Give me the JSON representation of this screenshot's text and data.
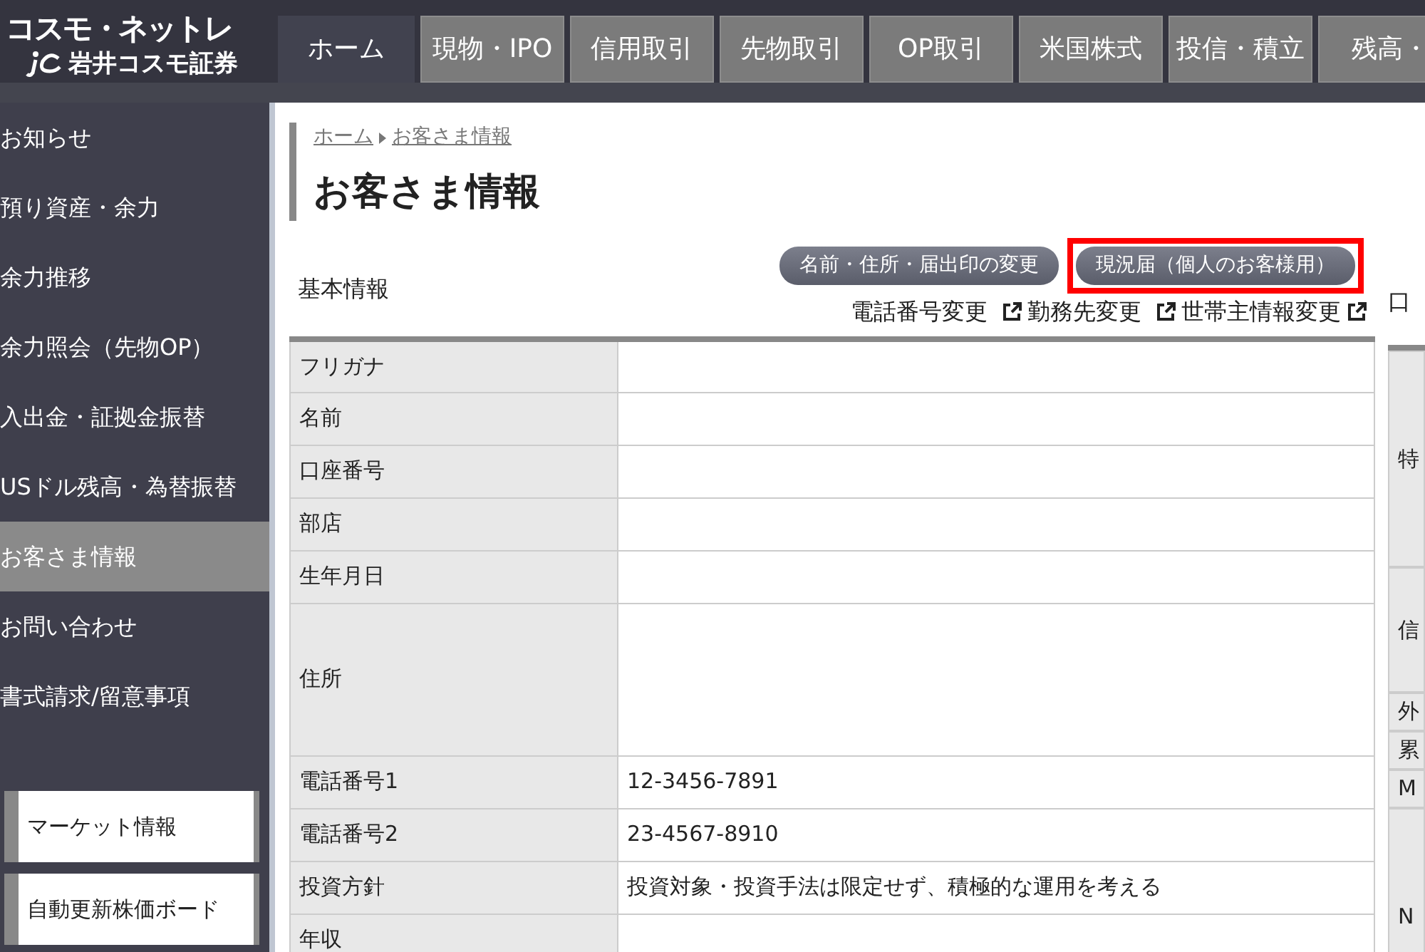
{
  "logo": {
    "title": "コスモ・ネットレ",
    "company": "岩井コスモ証券"
  },
  "tabs": [
    {
      "label": "ホーム",
      "selected": true
    },
    {
      "label": "現物・IPO",
      "selected": false
    },
    {
      "label": "信用取引",
      "selected": false
    },
    {
      "label": "先物取引",
      "selected": false
    },
    {
      "label": "OP取引",
      "selected": false
    },
    {
      "label": "米国株式",
      "selected": false
    },
    {
      "label": "投信・積立",
      "selected": false
    },
    {
      "label": "残高・",
      "selected": false
    }
  ],
  "sidebar": {
    "items": [
      {
        "label": "お知らせ",
        "selected": false
      },
      {
        "label": "預り資産・余力",
        "selected": false
      },
      {
        "label": "余力推移",
        "selected": false
      },
      {
        "label": "余力照会（先物OP）",
        "selected": false
      },
      {
        "label": "入出金・証拠金振替",
        "selected": false
      },
      {
        "label": "USドル残高・為替振替",
        "selected": false
      },
      {
        "label": "お客さま情報",
        "selected": true
      },
      {
        "label": "お問い合わせ",
        "selected": false
      },
      {
        "label": "書式請求/留意事項",
        "selected": false
      }
    ],
    "boxes": [
      "マーケット情報",
      "自動更新株価ボード"
    ]
  },
  "breadcrumb": [
    "ホーム",
    "お客さま情報"
  ],
  "page_title": "お客さま情報",
  "section": "基本情報",
  "buttons": [
    {
      "label": "名前・住所・届出印の変更",
      "highlighted": false
    },
    {
      "label": "現況届（個人のお客様用）",
      "highlighted": true
    }
  ],
  "links": [
    "電話番号変更",
    "勤務先変更",
    "世帯主情報変更"
  ],
  "table": {
    "rows": [
      {
        "label": "フリガナ",
        "value": "",
        "kind": "normal"
      },
      {
        "label": "名前",
        "value": "",
        "kind": "normal"
      },
      {
        "label": "口座番号",
        "value": "",
        "kind": "normal"
      },
      {
        "label": "部店",
        "value": "",
        "kind": "normal"
      },
      {
        "label": "生年月日",
        "value": "",
        "kind": "normal"
      },
      {
        "label": "住所",
        "value": "",
        "kind": "tall"
      },
      {
        "label": "電話番号1",
        "value": "12-3456-7891",
        "kind": "normal"
      },
      {
        "label": "電話番号2",
        "value": "23-4567-8910",
        "kind": "normal"
      },
      {
        "label": "投資方針",
        "value": "投資対象・投資手法は限定せず、積極的な運用を考える",
        "kind": "normal"
      },
      {
        "label": "年収",
        "value": "",
        "kind": "cut"
      }
    ]
  },
  "side_panel": {
    "heading": "口",
    "rows": [
      {
        "label": "特",
        "kind": "tall"
      },
      {
        "label": "信",
        "kind": "medium"
      },
      {
        "label": "外",
        "kind": "small"
      },
      {
        "label": "累",
        "kind": "small"
      },
      {
        "label": "M",
        "kind": "small"
      },
      {
        "label": "N",
        "kind": "tall"
      }
    ]
  }
}
